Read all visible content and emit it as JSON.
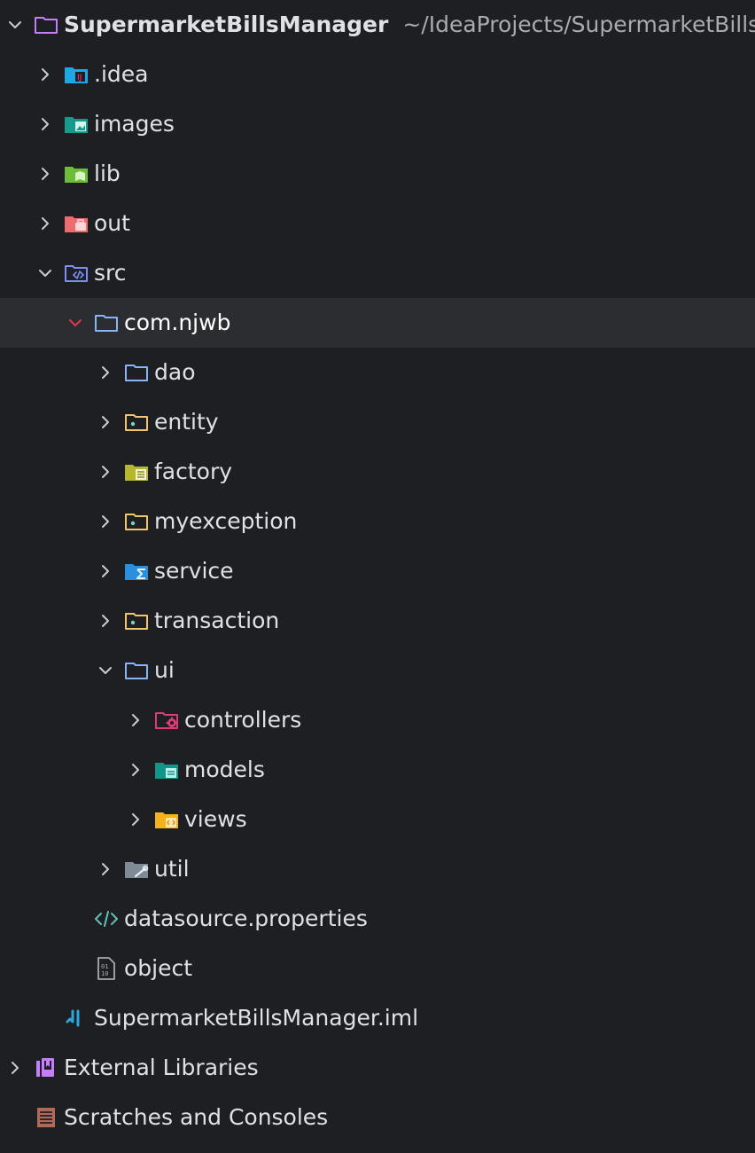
{
  "project": {
    "name": "SupermarketBillsManager",
    "path": "~/IdeaProjects/SupermarketBillsManager"
  },
  "items": {
    "idea": {
      "label": ".idea",
      "icon": "intellij-folder-icon"
    },
    "images": {
      "label": "images",
      "icon": "image-folder-icon"
    },
    "lib": {
      "label": "lib",
      "icon": "library-folder-icon"
    },
    "out": {
      "label": "out",
      "icon": "excluded-folder-icon"
    },
    "src": {
      "label": "src",
      "icon": "source-folder-icon"
    },
    "package": {
      "label": "com.njwb",
      "icon": "package-folder-icon"
    },
    "dao": {
      "label": "dao",
      "icon": "folder-icon"
    },
    "entity": {
      "label": "entity",
      "icon": "entity-folder-icon"
    },
    "factory": {
      "label": "factory",
      "icon": "factory-folder-icon"
    },
    "myexception": {
      "label": "myexception",
      "icon": "exception-folder-icon"
    },
    "service": {
      "label": "service",
      "icon": "service-folder-icon"
    },
    "transaction": {
      "label": "transaction",
      "icon": "transaction-folder-icon"
    },
    "ui": {
      "label": "ui",
      "icon": "folder-icon"
    },
    "controllers": {
      "label": "controllers",
      "icon": "controllers-folder-icon"
    },
    "models": {
      "label": "models",
      "icon": "models-folder-icon"
    },
    "views": {
      "label": "views",
      "icon": "views-folder-icon"
    },
    "util": {
      "label": "util",
      "icon": "util-folder-icon"
    },
    "datasource": {
      "label": "datasource.properties",
      "icon": "properties-file-icon"
    },
    "object": {
      "label": "object",
      "icon": "binary-file-icon"
    },
    "iml": {
      "label": "SupermarketBillsManager.iml",
      "icon": "iml-file-icon"
    },
    "external": {
      "label": "External Libraries",
      "icon": "external-libraries-icon"
    },
    "scratches": {
      "label": "Scratches and Consoles",
      "icon": "scratches-icon"
    }
  },
  "colors": {
    "background": "#1e1f22",
    "selected_row": "#2b2d30",
    "text": "#dfe1e5",
    "path_text": "#a8abb0",
    "chevron": "#c9ccd1",
    "selected_chevron": "#e5354f"
  }
}
